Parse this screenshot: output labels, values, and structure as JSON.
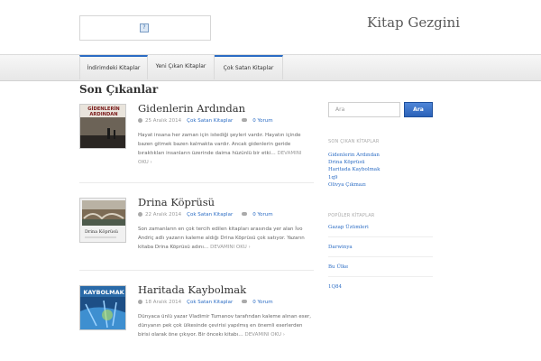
{
  "site": {
    "title": "Kitap Gezgini"
  },
  "nav": {
    "tabs": [
      "İndirimdeki Kitaplar",
      "Yeni Çıkan Kitaplar",
      "Çok Satan Kitaplar"
    ]
  },
  "main": {
    "heading": "Son Çıkanlar",
    "posts": [
      {
        "title": "Gidenlerin Ardından",
        "date": "25 Aralık 2014",
        "category": "Çok Satan Kitaplar",
        "comments": "0 Yorum",
        "excerpt": "Hayat insana her zaman için istediği şeyleri vardır. Hayatın içinde bazen gitmek bazen kalmakta vardır. Ancak gidenlerin geride bıraktıkları insanların üzerinde daima hüzünlü bir etki…",
        "more": "DEVAMINI OKU ›",
        "cover_text": [
          "GİDENLERİN",
          "ARDINDAN"
        ]
      },
      {
        "title": "Drina Köprüsü",
        "date": "22 Aralık 2014",
        "category": "Çok Satan Kitaplar",
        "comments": "0 Yorum",
        "excerpt": "Son zamanların en çok tercih edilen kitapları arasında yer alan İvo Andriç adlı yazarın kaleme aldığı Drina Köprüsü çok satıyor. Yazarın kitaba Drina Köprüsü adını…",
        "more": "DEVAMINI OKU ›",
        "cover_text": [
          "Drina Köprüsü"
        ]
      },
      {
        "title": "Haritada Kaybolmak",
        "date": "18 Aralık 2014",
        "category": "Çok Satan Kitaplar",
        "comments": "0 Yorum",
        "excerpt": "Dünyaca ünlü yazar Vladimir Tumanov tarafından kaleme alınan eser, dünyanın pek çok ülkesinde çevirisi yapılmış en önemli eserlerden birisi olarak öne çıkıyor. Bir öncekı kitabı…",
        "more": "DEVAMINI OKU ›",
        "cover_text": [
          "KAYBOLMAK"
        ]
      }
    ]
  },
  "sidebar": {
    "search": {
      "placeholder": "Ara",
      "button": "Ara"
    },
    "new_books": {
      "title": "SON ÇIKAN KİTAPLAR",
      "items": [
        "Gidenlerin Ardından",
        "Drina Köprüsü",
        "Haritada Kaybolmak",
        "1q9",
        "Olivya Çıkmazı"
      ]
    },
    "popular": {
      "title": "POPÜLER KİTAPLAR",
      "items": [
        "Gazap Üzümleri",
        "Darwinya",
        "Bu Ülke",
        "1Q84"
      ]
    }
  },
  "colors": {
    "accent": "#2b6cc4",
    "button": "#3b74cc"
  }
}
